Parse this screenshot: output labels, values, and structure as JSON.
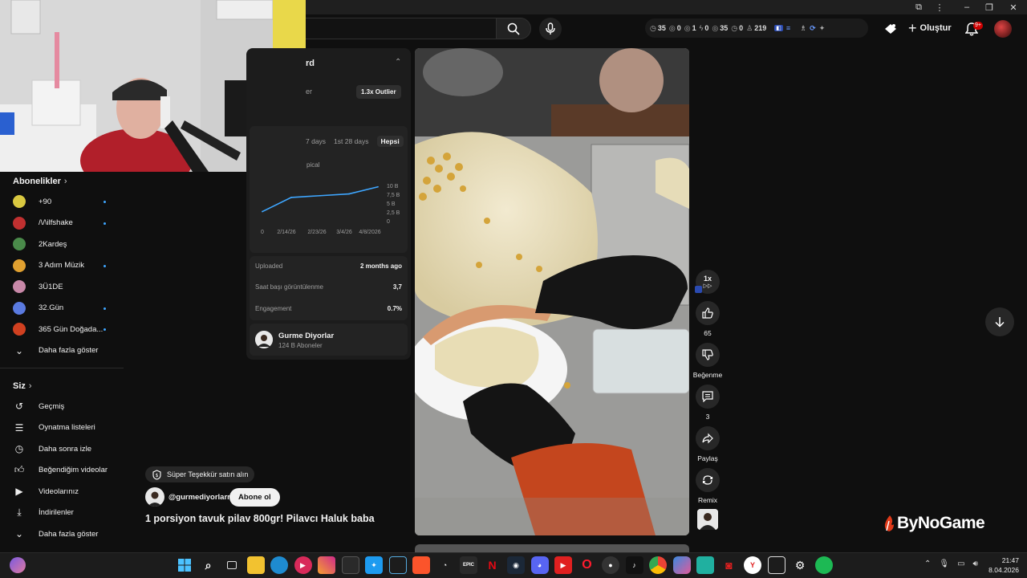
{
  "header": {
    "stats": [
      {
        "icon": "clock-icon",
        "value": "35"
      },
      {
        "icon": "eye-icon",
        "value": "0"
      },
      {
        "icon": "eye-icon",
        "value": "1"
      },
      {
        "icon": "bolt-icon",
        "value": "0"
      },
      {
        "icon": "eye-icon",
        "value": "35"
      },
      {
        "icon": "clock-icon",
        "value": "0"
      },
      {
        "icon": "person-icon",
        "value": "219"
      }
    ],
    "create_label": "Oluştur",
    "notif_count": "9+"
  },
  "sidebar": {
    "subscriptions_title": "Abonelikler",
    "channels": [
      {
        "name": "+90",
        "color": "#d9c840",
        "live": true
      },
      {
        "name": "/\\/\\ilfshake",
        "color": "#c03030",
        "live": true
      },
      {
        "name": "2Kardeş",
        "color": "#4a8a4a",
        "live": false
      },
      {
        "name": "3 Adım Müzik",
        "color": "#e0a030",
        "live": true
      },
      {
        "name": "3Ü1DE",
        "color": "#c888a8",
        "live": false
      },
      {
        "name": "32.Gün",
        "color": "#5a7ae0",
        "live": true
      },
      {
        "name": "365 Gün Doğada...",
        "color": "#d04020",
        "live": true
      }
    ],
    "show_more": "Daha fazla göster",
    "you_title": "Siz",
    "you_items": [
      {
        "icon": "history-icon",
        "label": "Geçmiş"
      },
      {
        "icon": "playlist-icon",
        "label": "Oynatma listeleri"
      },
      {
        "icon": "watch-later-icon",
        "label": "Daha sonra izle"
      },
      {
        "icon": "liked-icon",
        "label": "Beğendiğim videolar"
      },
      {
        "icon": "your-videos-icon",
        "label": "Videolarınız"
      },
      {
        "icon": "download-icon",
        "label": "İndirilenler"
      }
    ],
    "show_more_2": "Daha fazla göster"
  },
  "panel": {
    "title_fragment": "rd",
    "row_fragment": "er",
    "outlier_badge": "1.3x Outlier",
    "tabs": [
      "7 days",
      "1st 28 days",
      "Hepsi"
    ],
    "active_tab": "Hepsi",
    "typical_fragment": "pical",
    "uploaded_label": "Uploaded",
    "uploaded_value": "2 months ago",
    "per_hour_label": "Saat başı görüntülenme",
    "per_hour_value": "3,7",
    "engagement_label": "Engagement",
    "engagement_value": "0.7%",
    "channel_name": "Gurme Diyorlar",
    "channel_subs": "124 B Aboneler"
  },
  "chart_data": {
    "type": "line",
    "x": [
      "0",
      "2/14/26",
      "2/23/26",
      "3/4/26",
      "4/8/26"
    ],
    "x_tick_labels": [
      "0",
      "2/14/26",
      "2/23/26",
      "3/4/26",
      "4/8/2026"
    ],
    "y_tick_labels": [
      "10 B",
      "7,5 B",
      "5 B",
      "2,5 B",
      "0"
    ],
    "ylim": [
      0,
      10
    ],
    "series": [
      {
        "values": [
          2.6,
          6.6,
          7.1,
          7.6,
          9.6
        ],
        "color": "#3ea6ff"
      }
    ]
  },
  "actions": {
    "speed": "1x",
    "like_count": "65",
    "dislike_label": "Beğenme",
    "comment_count": "3",
    "share_label": "Paylaş",
    "remix_label": "Remix"
  },
  "video": {
    "super_thanks": "Süper Teşekkür satın alın",
    "channel_handle": "@gurmediyorlarr",
    "subscribe_label": "Abone ol",
    "title": "1 porsiyon tavuk pilav 800gr! Pilavcı Haluk baba"
  },
  "watermark": "ByNoGame",
  "taskbar": {
    "time": "21:47",
    "date": "8.04.2026"
  }
}
